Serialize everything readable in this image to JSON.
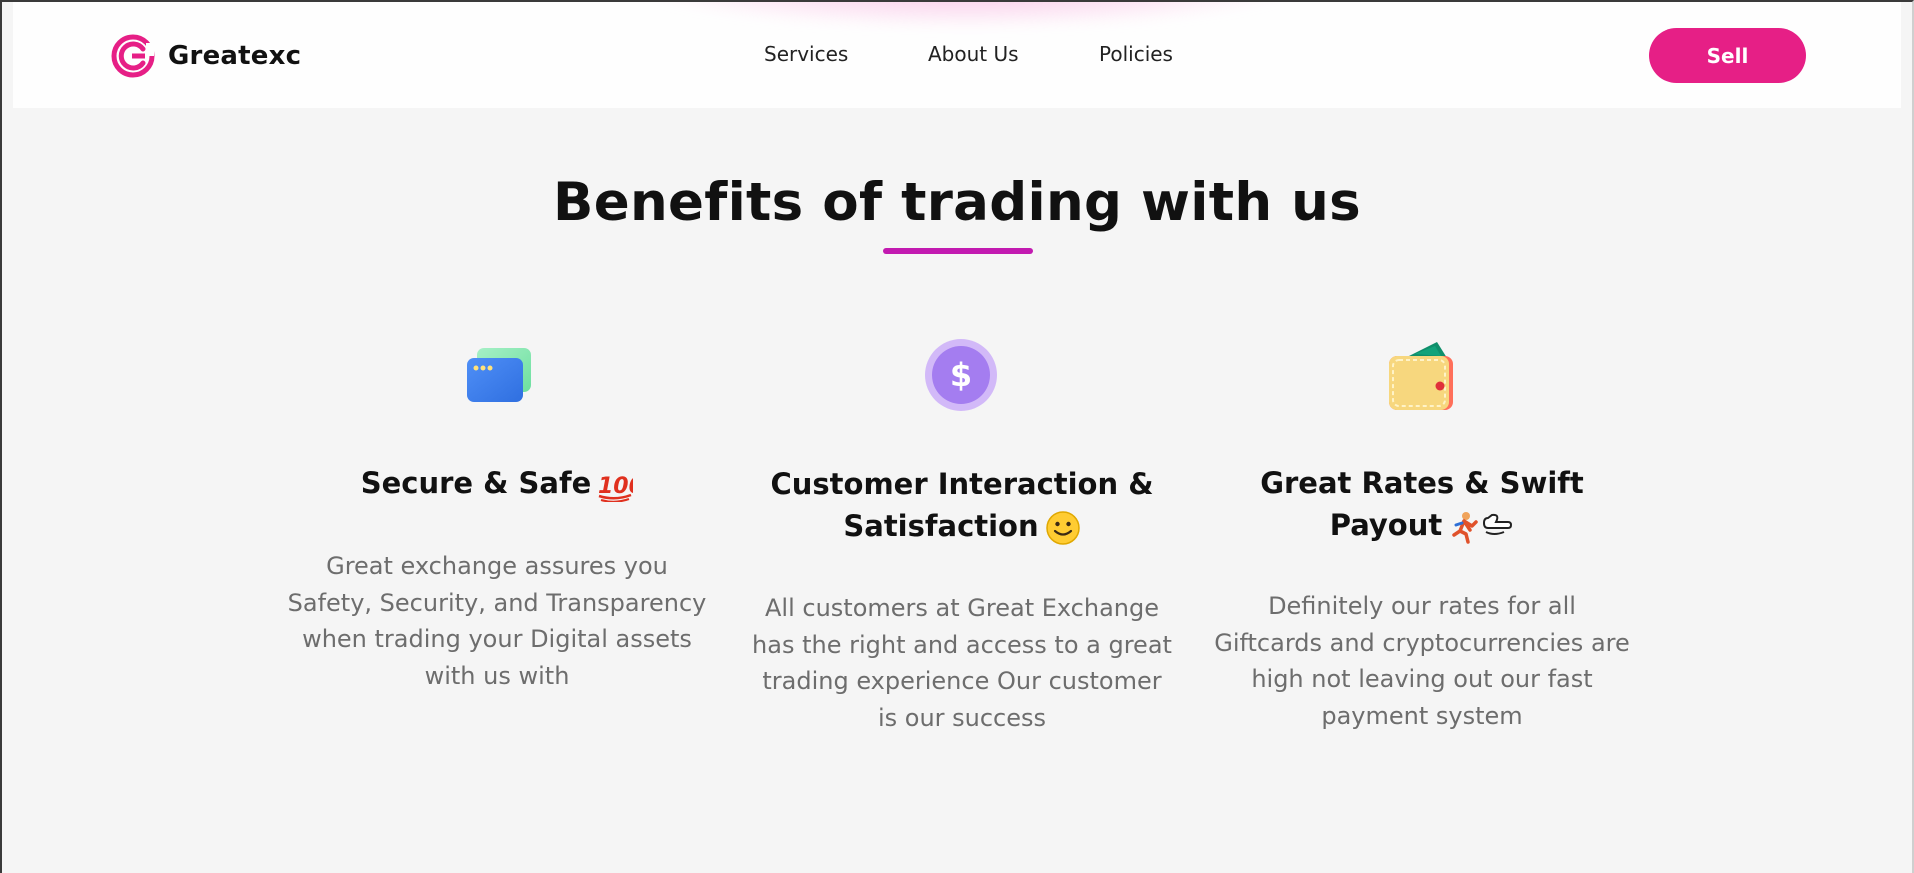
{
  "brand": {
    "name": "Greatexc",
    "accent": "#e61f86"
  },
  "nav": {
    "links": [
      "Services",
      "About Us",
      "Policies"
    ],
    "cta": "Sell"
  },
  "section": {
    "heading": "Benefits of trading with us",
    "underline_color": "#c21ab0"
  },
  "benefits": [
    {
      "icon": "credit-card-icon",
      "title": "Secure & Safe",
      "title_emoji": "hundred-points-icon",
      "description": "Great exchange assures you Safety, Security, and Transparency when trading your Digital assets with us with"
    },
    {
      "icon": "dollar-coin-icon",
      "title": "Customer Interaction & Satisfaction",
      "title_emoji": "smiling-face-icon",
      "description": "All customers at Great Exchange has the right and access to a great trading experience Our customer is our success"
    },
    {
      "icon": "wallet-icon",
      "title": "Great Rates & Swift Payout",
      "title_emoji": "running-person-dash-icon",
      "description": "Definitely our rates for all Giftcards and cryptocurrencies are high not leaving out our fast payment system"
    }
  ]
}
